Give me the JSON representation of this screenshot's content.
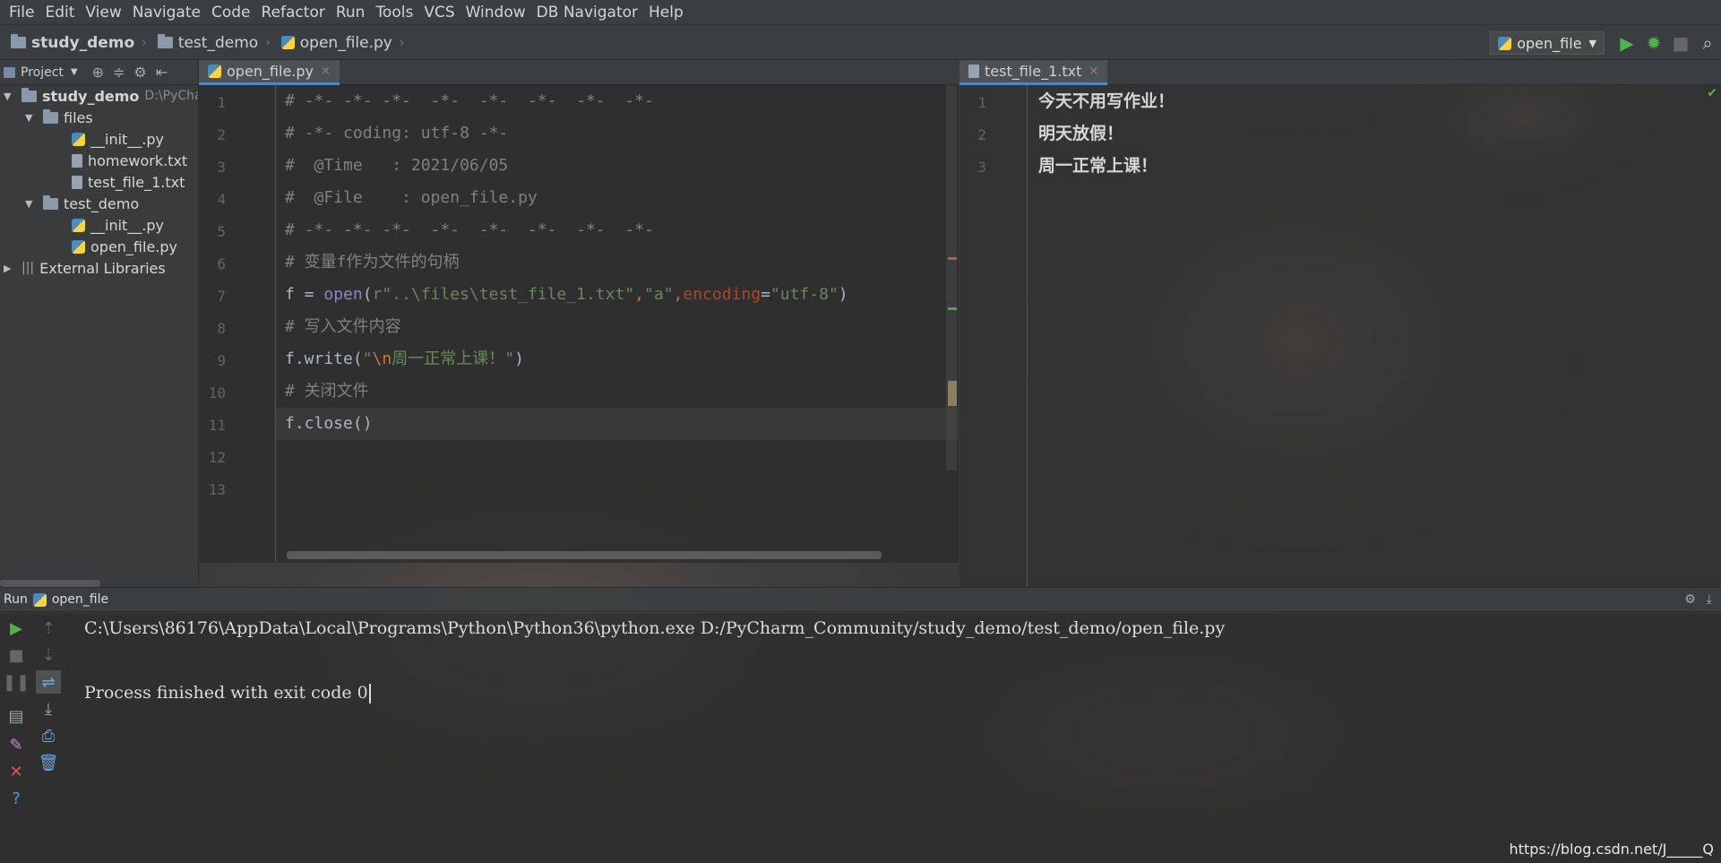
{
  "menu": [
    "File",
    "Edit",
    "View",
    "Navigate",
    "Code",
    "Refactor",
    "Run",
    "Tools",
    "VCS",
    "Window",
    "DB Navigator",
    "Help"
  ],
  "breadcrumb": {
    "project": "study_demo",
    "folder": "test_demo",
    "file": "open_file.py"
  },
  "run_config": {
    "name": "open_file"
  },
  "project_panel": {
    "label": "Project",
    "root": "study_demo",
    "root_path": "D:\\PyCharm",
    "items": [
      {
        "name": "files"
      },
      {
        "name": "__init__.py"
      },
      {
        "name": "homework.txt"
      },
      {
        "name": "test_file_1.txt"
      },
      {
        "name": "test_demo"
      },
      {
        "name": "__init__.py"
      },
      {
        "name": "open_file.py"
      },
      {
        "name": "External Libraries"
      }
    ]
  },
  "editor": {
    "tab": "open_file.py",
    "line_numbers": [
      "1",
      "2",
      "3",
      "4",
      "5",
      "6",
      "7",
      "8",
      "9",
      "10",
      "11",
      "12",
      "13"
    ],
    "lines": {
      "l1": "# -*- -*- -*-  -*-  -*-  -*-  -*-  -*-",
      "l2": "# -*- coding: utf-8 -*-",
      "l3": "#  @Time   : 2021/06/05",
      "l4": "#  @File    : open_file.py",
      "l5": "# -*- -*- -*-  -*-  -*-  -*-  -*-  -*-",
      "l6": "# 变量f作为文件的句柄",
      "l7_var": "f",
      "l7_eq": " = ",
      "l7_fn": "open",
      "l7_p1": "(",
      "l7_s1": "r\"..\\files\\test_file_1.txt\"",
      "l7_c1": ",",
      "l7_s2": "\"a\"",
      "l7_c2": ",",
      "l7_kw": "encoding",
      "l7_eq2": "=",
      "l7_s3": "\"utf-8\"",
      "l7_p2": ")",
      "l8": "# 写入文件内容",
      "l9_pre": "f.write(",
      "l9_q1": "\"",
      "l9_esc": "\\n",
      "l9_str": "周一正常上课！\"",
      "l9_post": ")",
      "l10": "# 关闭文件",
      "l11": "f.close()"
    }
  },
  "right_editor": {
    "tab": "test_file_1.txt",
    "line_numbers": [
      "1",
      "2",
      "3"
    ],
    "lines": [
      "今天不用写作业！",
      "明天放假！",
      "周一正常上课！"
    ]
  },
  "run_panel": {
    "label": "Run",
    "config": "open_file",
    "output_cmd": "C:\\Users\\86176\\AppData\\Local\\Programs\\Python\\Python36\\python.exe D:/PyCharm_Community/study_demo/test_demo/open_file.py",
    "output_exit": "Process finished with exit code 0"
  },
  "watermark": "https://blog.csdn.net/J_____Q",
  "colors": {
    "accent": "#4a88c7",
    "run_green": "#4eb348",
    "comment": "#808080",
    "string": "#6a8759"
  }
}
